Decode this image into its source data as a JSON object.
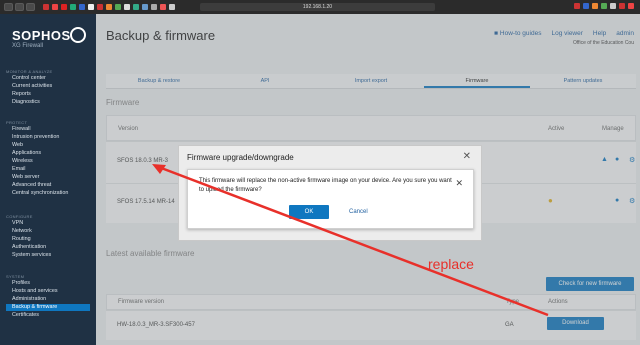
{
  "browser": {
    "url": "192.168.1.20",
    "nav_glyphs": [
      "‹",
      "›",
      "□"
    ]
  },
  "brand": {
    "name": "SOPHOS",
    "product": "XG Firewall"
  },
  "sidebar": {
    "sections": [
      {
        "title": "MONITOR & ANALYZE",
        "items": [
          "Control center",
          "Current activities",
          "Reports",
          "Diagnostics"
        ]
      },
      {
        "title": "PROTECT",
        "items": [
          "Firewall",
          "Intrusion prevention",
          "Web",
          "Applications",
          "Wireless",
          "Email",
          "Web server",
          "Advanced threat",
          "Central synchronization"
        ]
      },
      {
        "title": "CONFIGURE",
        "items": [
          "VPN",
          "Network",
          "Routing",
          "Authentication",
          "System services"
        ]
      },
      {
        "title": "SYSTEM",
        "items": [
          "Profiles",
          "Hosts and services",
          "Administration",
          "Backup & firmware",
          "Certificates"
        ]
      }
    ],
    "active": "Backup & firmware"
  },
  "header": {
    "title": "Backup & firmware",
    "links": [
      "How-to guides",
      "Log viewer",
      "Help",
      "admin"
    ],
    "org": "Office of the Education Cou"
  },
  "tabs": [
    "Backup & restore",
    "API",
    "Import export",
    "Firmware",
    "Pattern updates"
  ],
  "active_tab": "Firmware",
  "firmware": {
    "heading": "Firmware",
    "columns": {
      "version": "Version",
      "active": "Active",
      "manage": "Manage"
    },
    "rows": [
      {
        "version": "SFOS 18.0.3 MR-3"
      },
      {
        "version": "SFOS 17.5.14 MR-14"
      }
    ]
  },
  "latest": {
    "heading": "Latest available firmware",
    "check_button": "Check for new firmware",
    "columns": {
      "version": "Firmware version",
      "type": "Type",
      "actions": "Actions"
    },
    "rows": [
      {
        "version": "HW-18.0.3_MR-3.SF300-457",
        "type": "GA",
        "action": "Download"
      }
    ]
  },
  "dialog_outer": {
    "title": "Firmware upgrade/downgrade",
    "close": "✕"
  },
  "dialog_inner": {
    "message": "This firmware will replace the non-active firmware image on your device. Are you sure you want to upload the firmware?",
    "ok": "OK",
    "cancel": "Cancel",
    "close": "✕"
  },
  "annotation": {
    "text": "replace",
    "color": "#e8302a"
  },
  "colors": {
    "accent": "#0f77c0",
    "sidebar": "#1f3144",
    "annotation": "#e8302a",
    "active_dot": "#e0b020"
  }
}
